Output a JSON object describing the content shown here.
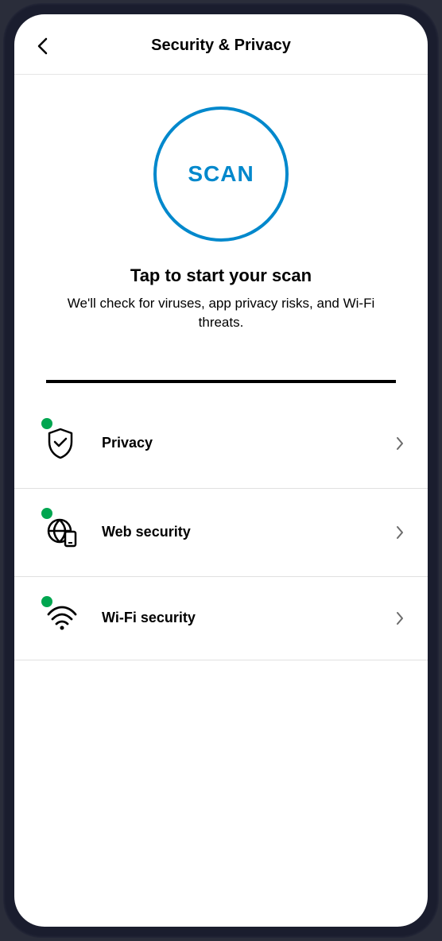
{
  "header": {
    "title": "Security & Privacy"
  },
  "scan": {
    "button_label": "SCAN",
    "title": "Tap to start your scan",
    "description": "We'll check for viruses, app privacy risks, and Wi-Fi threats."
  },
  "list": {
    "items": [
      {
        "label": "Privacy",
        "status": "ok"
      },
      {
        "label": "Web security",
        "status": "ok"
      },
      {
        "label": "Wi-Fi security",
        "status": "ok"
      }
    ]
  },
  "colors": {
    "accent": "#0088cc",
    "status_ok": "#00a650"
  }
}
